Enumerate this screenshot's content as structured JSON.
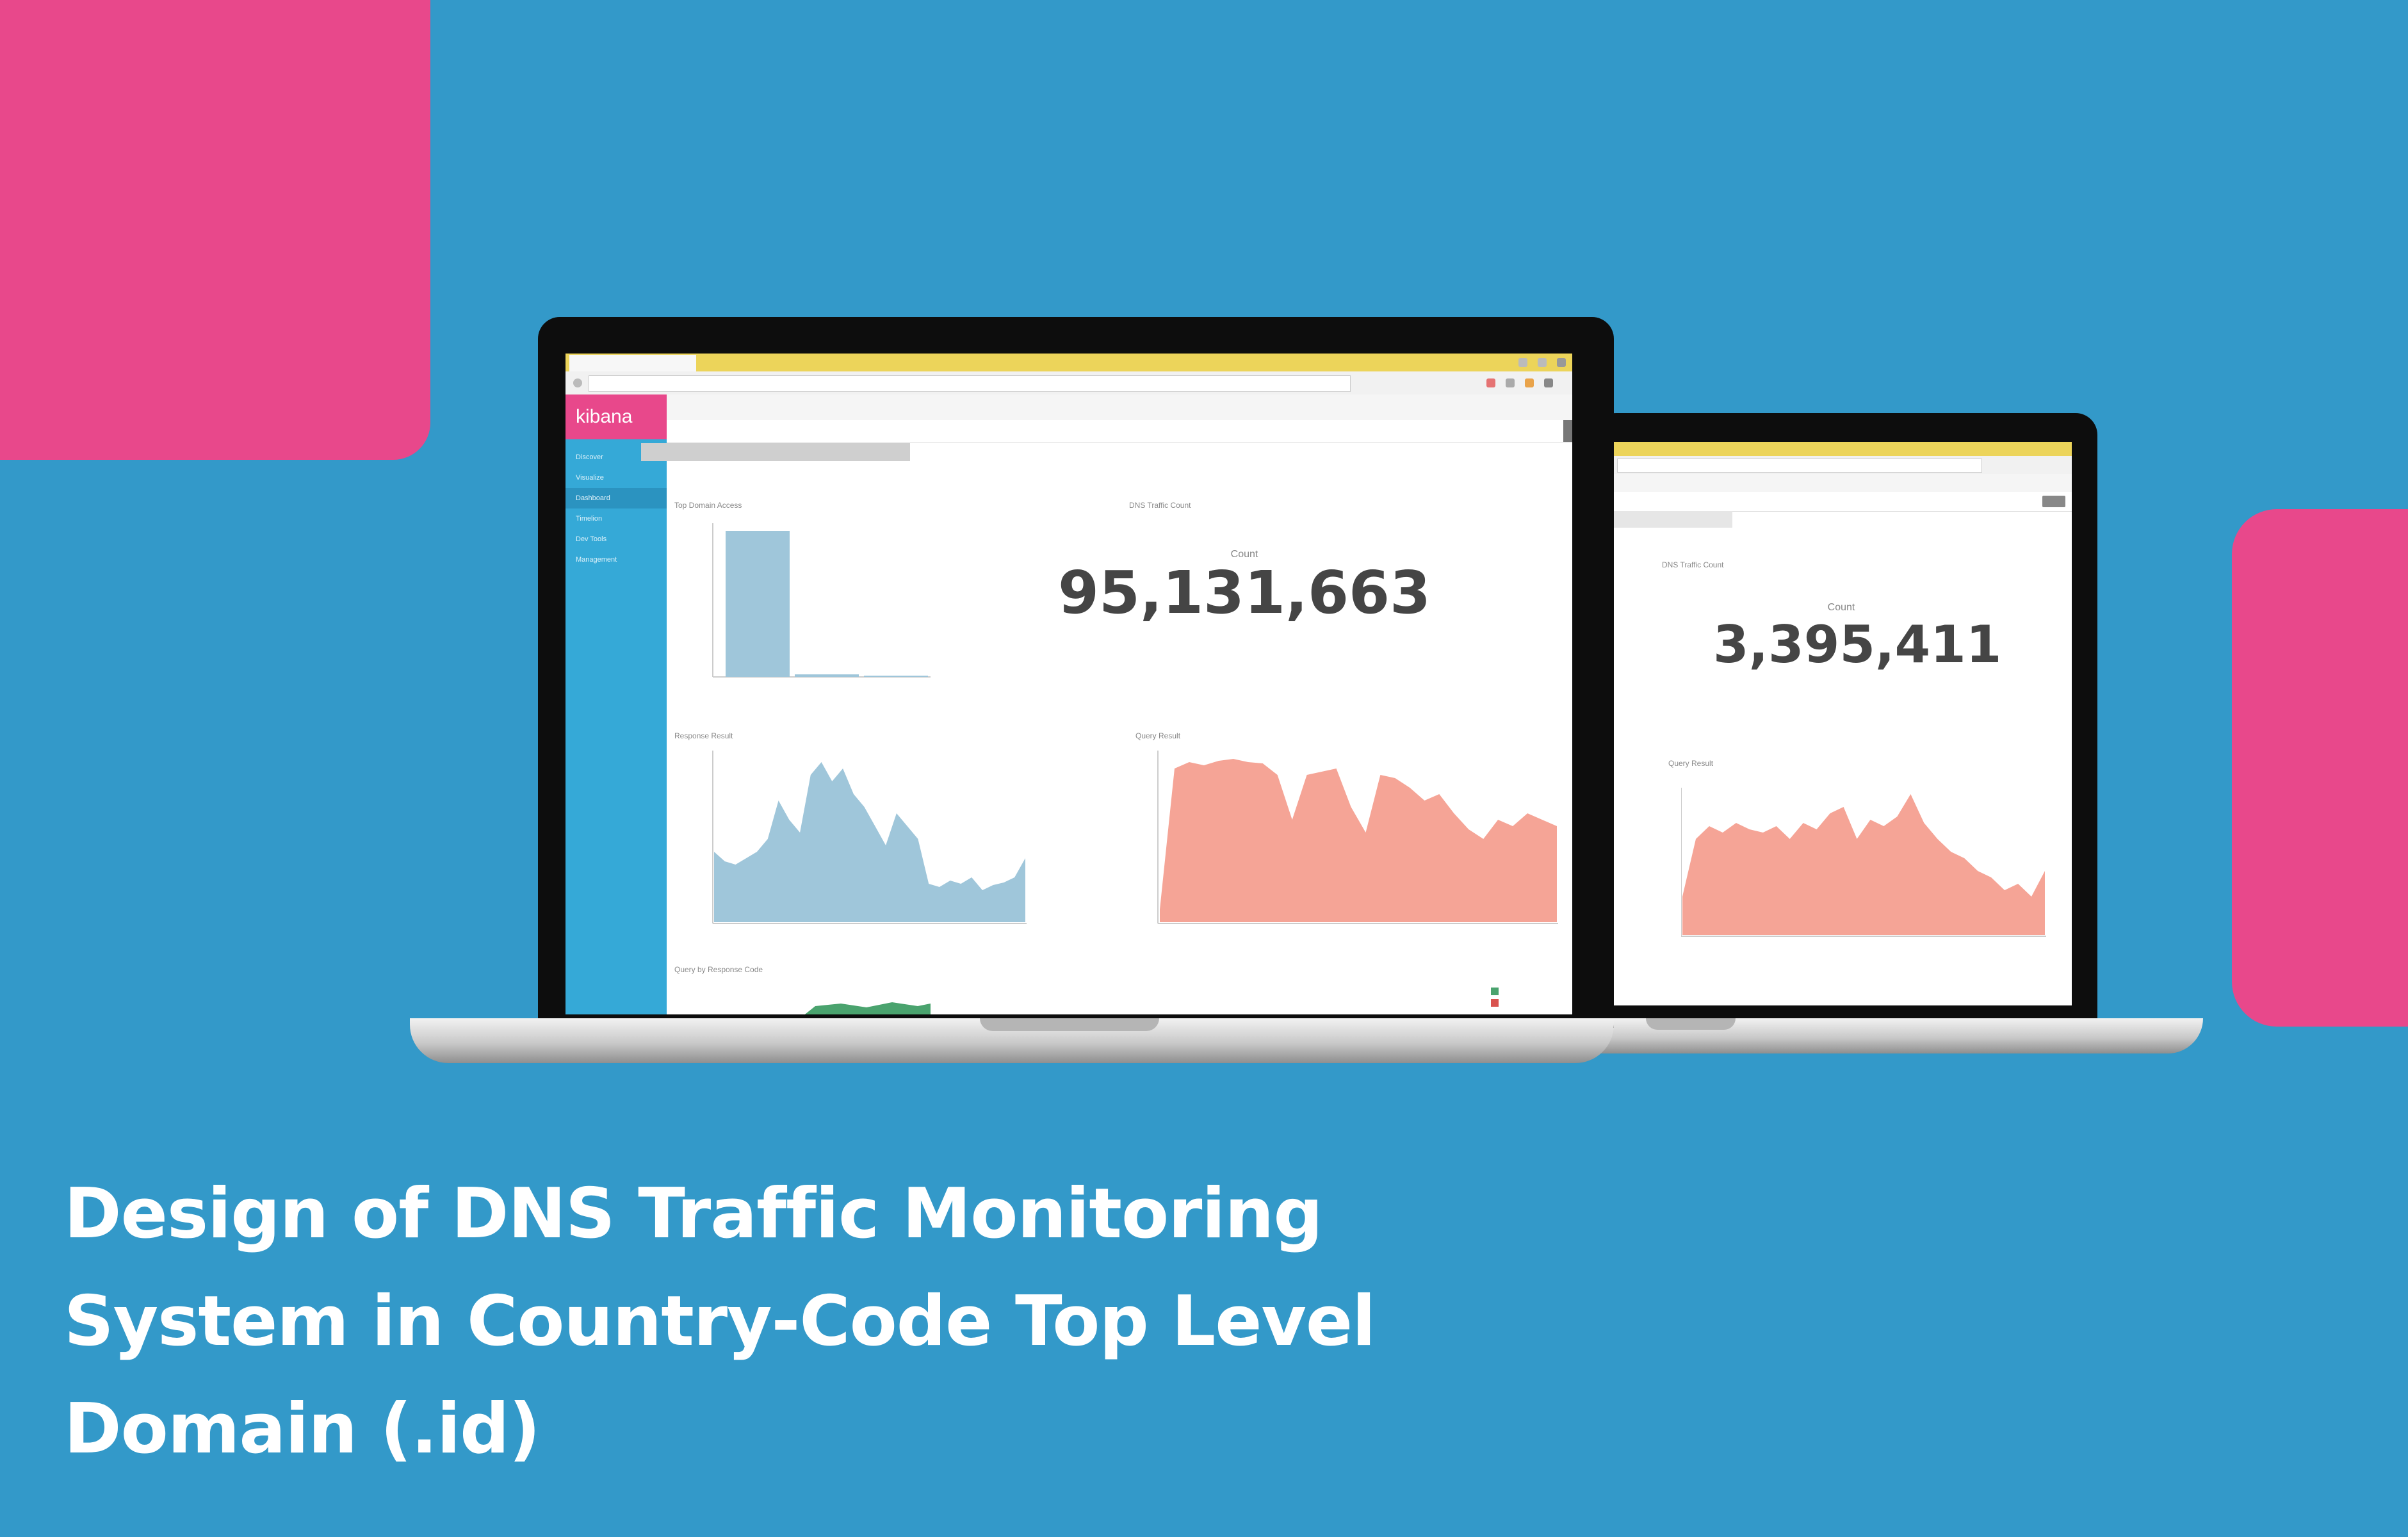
{
  "colors": {
    "background": "#3399c9",
    "accent_pink": "#e8488b",
    "kibana_sidebar": "#35a9d7",
    "chart_blue": "#9fc6da",
    "chart_salmon": "#f5a496",
    "chart_green": "#4aa36e"
  },
  "caption": {
    "line1": "Design of DNS Traffic Monitoring",
    "line2": "System in Country-Code Top Level",
    "line3": "Domain (.id)"
  },
  "laptop_main": {
    "app_logo": "kibana",
    "metric_label": "Count",
    "metric_value": "95,131,663",
    "panel_metric_title": "DNS Traffic Count",
    "panel_bar_title": "Top Domain Access",
    "panel_response_title": "Response Result",
    "panel_query_title": "Query Result",
    "panel_code_title": "Query by Response Code",
    "nav": [
      "Discover",
      "Visualize",
      "Dashboard",
      "Timelion",
      "Dev Tools",
      "Management"
    ],
    "active_nav": "Dashboard"
  },
  "laptop_secondary": {
    "metric_label": "Count",
    "metric_value": "3,395,411",
    "panel_metric_title": "DNS Traffic Count",
    "panel_query_title": "Query Result"
  }
}
